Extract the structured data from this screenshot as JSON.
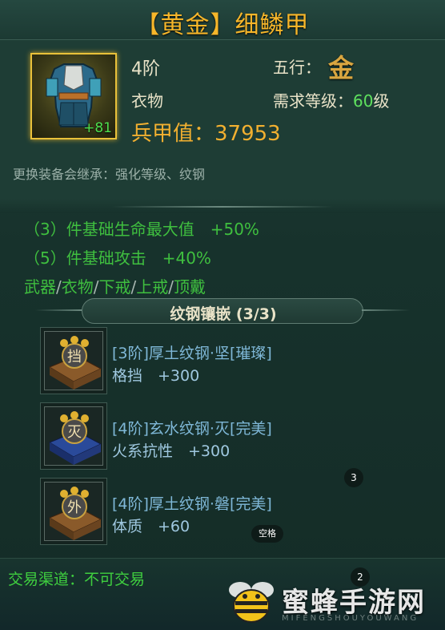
{
  "item": {
    "title": "【黄金】细鳞甲",
    "enhance": "+81",
    "tier": "4阶",
    "wuxing_label": "五行：",
    "wuxing_glyph": "金",
    "slot": "衣物",
    "req_label": "需求等级：",
    "req_level": "60",
    "req_unit": "级",
    "power": "兵甲值：37953",
    "inherit_note": "更换装备会继承：强化等级、纹钢"
  },
  "set_bonus": {
    "line1": "（3）件基础生命最大值　+50%",
    "line2": "（5）件基础攻击　+40%",
    "parts": [
      "武器",
      "衣物",
      "下戒",
      "上戒",
      "顶戴"
    ],
    "separator": "/"
  },
  "gems": {
    "section_title": "纹钢镶嵌 (3/3)",
    "items": [
      {
        "glyph": "挡",
        "name": "[3阶]厚土纹钢·坚[璀璨]",
        "stat": "格挡　+300",
        "color": "#8a5a2a"
      },
      {
        "glyph": "灭",
        "name": "[4阶]玄水纹钢·灭[完美]",
        "stat": "火系抗性　+300",
        "color": "#2a4a9a"
      },
      {
        "glyph": "外",
        "name": "[4阶]厚土纹钢·磐[完美]",
        "stat": "体质　+60",
        "color": "#8a5a2a"
      }
    ]
  },
  "overlays": {
    "badge_a": "3",
    "badge_b": "2",
    "space_tag": "空格"
  },
  "trade": "交易渠道：不可交易",
  "watermark": {
    "text": "蜜蜂手游网",
    "sub": "MIFENGSHOUYOUWANG"
  },
  "colors": {
    "gold": "#f6b62a",
    "set_green": "#3fbf3f",
    "gem_blue": "#7fb8d8"
  }
}
